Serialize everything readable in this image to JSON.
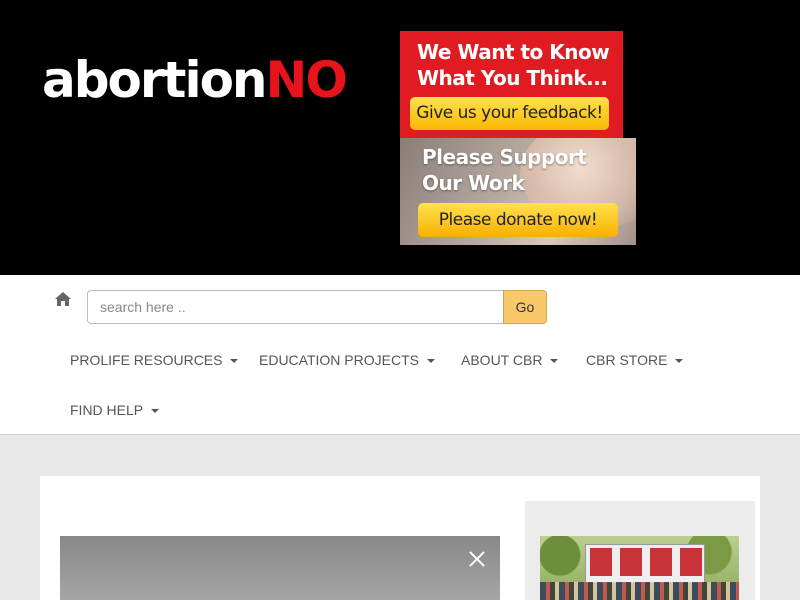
{
  "header": {
    "logo_part1": "abortion",
    "logo_part2": "NO",
    "feedback_banner": {
      "title": "We Want to Know What You Think...",
      "button": "Give us your feedback!"
    },
    "donate_banner": {
      "title": "Please Support Our Work",
      "button": "Please donate now!"
    }
  },
  "nav": {
    "home_icon": "home-icon",
    "search": {
      "placeholder": "search here ..",
      "value": "",
      "button_label": "Go"
    },
    "menu": [
      "PROLIFE RESOURCES",
      "EDUCATION PROJECTS",
      "ABOUT CBR",
      "CBR STORE",
      "FIND HELP"
    ]
  },
  "content": {
    "close_icon": "close-icon"
  },
  "colors": {
    "header_bg": "#000000",
    "brand_red": "#e8141b",
    "banner_yellow": "#f9c23a",
    "go_button": "#f9c86b"
  }
}
